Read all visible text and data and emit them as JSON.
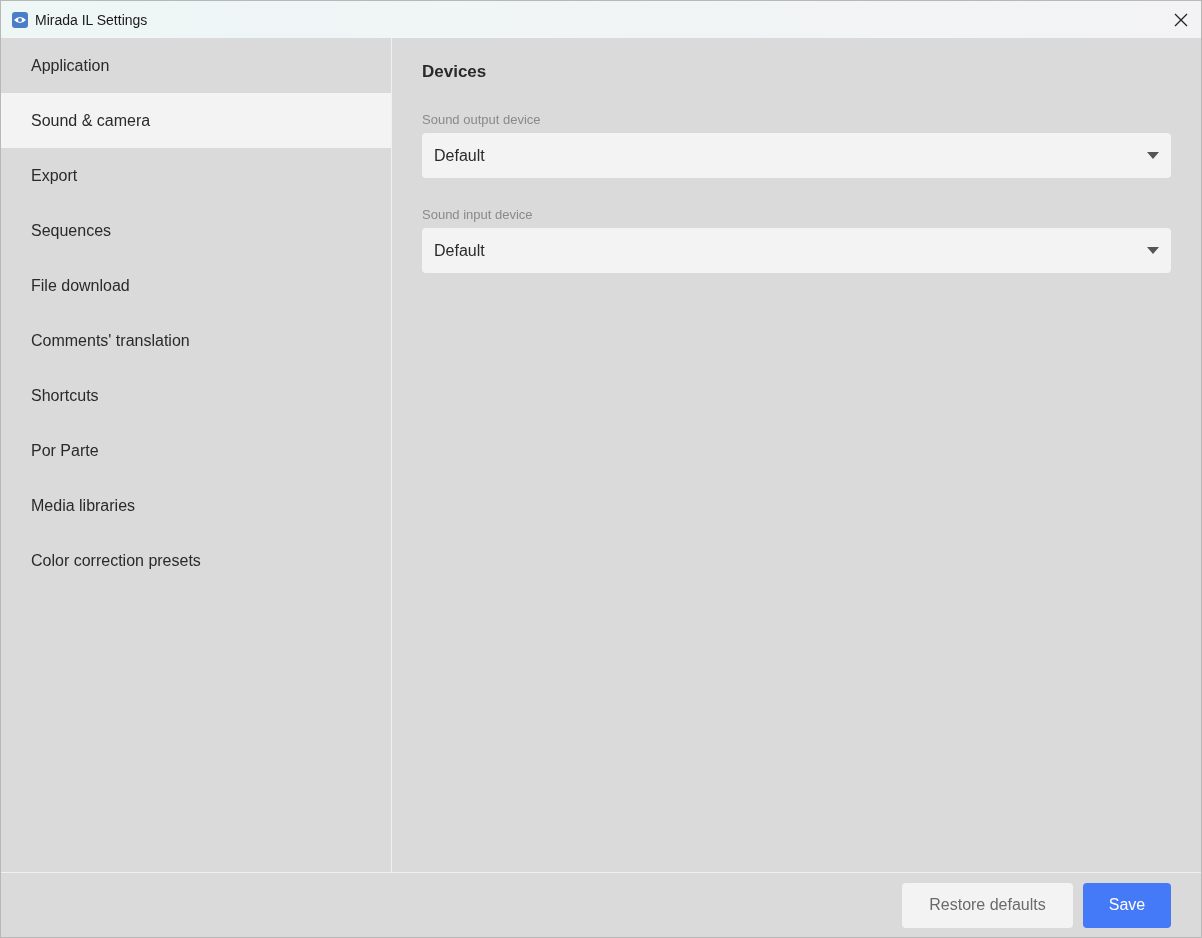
{
  "window": {
    "title": "Mirada IL Settings"
  },
  "sidebar": {
    "items": [
      {
        "label": "Application",
        "selected": false
      },
      {
        "label": "Sound & camera",
        "selected": true
      },
      {
        "label": "Export",
        "selected": false
      },
      {
        "label": "Sequences",
        "selected": false
      },
      {
        "label": "File download",
        "selected": false
      },
      {
        "label": "Comments' translation",
        "selected": false
      },
      {
        "label": "Shortcuts",
        "selected": false
      },
      {
        "label": "Por Parte",
        "selected": false
      },
      {
        "label": "Media libraries",
        "selected": false
      },
      {
        "label": "Color correction presets",
        "selected": false
      }
    ]
  },
  "content": {
    "heading": "Devices",
    "fields": [
      {
        "label": "Sound output device",
        "value": "Default"
      },
      {
        "label": "Sound input device",
        "value": "Default"
      }
    ]
  },
  "footer": {
    "buttons": [
      {
        "label": "Restore defaults",
        "kind": "secondary"
      },
      {
        "label": "Save",
        "kind": "primary"
      }
    ]
  }
}
